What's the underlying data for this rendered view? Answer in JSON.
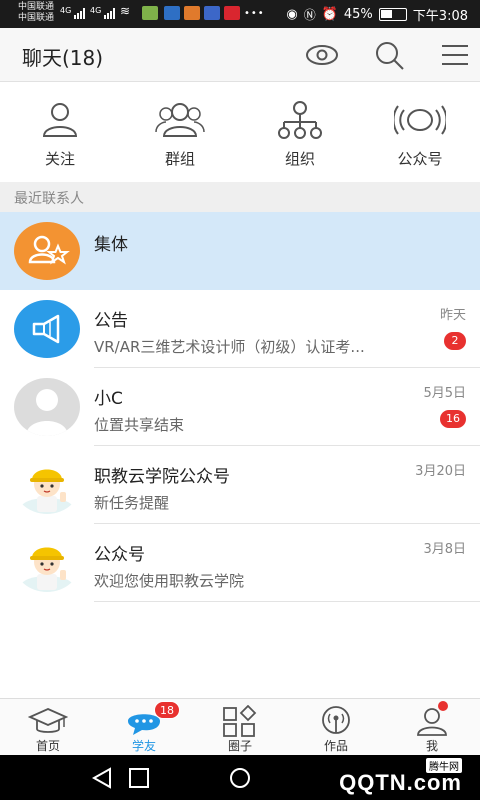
{
  "status_bar": {
    "carrier_1": "中国联通",
    "carrier_2": "中国联通",
    "network_1": "4G",
    "network_2": "4G",
    "battery": "45%",
    "time": "下午3:08",
    "dots": "•••"
  },
  "header": {
    "title": "聊天(18)",
    "icons": [
      "eye-icon",
      "search-icon",
      "menu-icon"
    ]
  },
  "quick_nav": [
    {
      "label": "关注",
      "icon": "person-icon"
    },
    {
      "label": "群组",
      "icon": "group-icon"
    },
    {
      "label": "组织",
      "icon": "org-chart-icon"
    },
    {
      "label": "公众号",
      "icon": "broadcast-icon"
    }
  ],
  "section": {
    "label": "最近联系人"
  },
  "conversations": [
    {
      "name": "集体",
      "subtitle": "",
      "time": "",
      "badge": "",
      "avatar": "collective-avatar",
      "color": "#f39332"
    },
    {
      "name": "公告",
      "subtitle": "VR/AR三维艺术设计师（初级）认证考...",
      "time": "昨天",
      "badge": "2",
      "avatar": "megaphone-avatar",
      "color": "#2b9ce8"
    },
    {
      "name": "小C",
      "subtitle": "位置共享结束",
      "time": "5月5日",
      "badge": "16",
      "avatar": "default-user-avatar",
      "color": "#dcdcdc"
    },
    {
      "name": "职教云学院公众号",
      "subtitle": "新任务提醒",
      "time": "3月20日",
      "badge": "",
      "avatar": "worker-avatar",
      "color": "#ffcc00"
    },
    {
      "name": "公众号",
      "subtitle": "欢迎您使用职教云学院",
      "time": "3月8日",
      "badge": "",
      "avatar": "worker-avatar",
      "color": "#ffcc00"
    }
  ],
  "tabs": [
    {
      "label": "首页",
      "icon": "graduation-cap-icon",
      "badge": ""
    },
    {
      "label": "学友",
      "icon": "chat-bubble-icon",
      "badge": "18"
    },
    {
      "label": "圈子",
      "icon": "grid-icon",
      "badge": ""
    },
    {
      "label": "作品",
      "icon": "signal-tower-icon",
      "badge": ""
    },
    {
      "label": "我",
      "icon": "profile-icon",
      "badge": ""
    }
  ],
  "watermark": {
    "small": "腾牛网",
    "main": "QQTN.com"
  },
  "colors": {
    "accent": "#2196e4",
    "badge": "#e8312f",
    "selected_row": "#d4e8f9"
  }
}
